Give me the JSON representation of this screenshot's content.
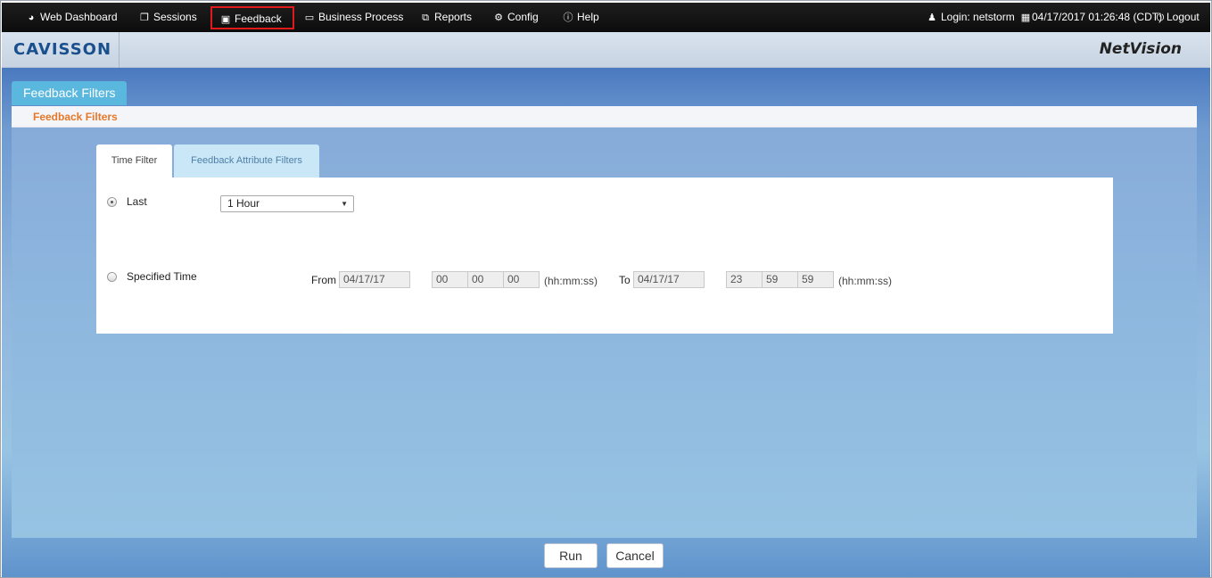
{
  "nav": {
    "web_dashboard": "Web Dashboard",
    "sessions": "Sessions",
    "feedback": "Feedback",
    "business_process": "Business Process",
    "reports": "Reports",
    "config": "Config",
    "help": "Help",
    "login": "Login: netstorm",
    "datetime": "04/17/2017 01:26:48 (CDT)",
    "logout": "Logout"
  },
  "brand": {
    "logo": "CAVISSON",
    "product": "NetVision"
  },
  "page": {
    "tab_title": "Feedback Filters",
    "breadcrumb": "Feedback Filters"
  },
  "tabs": [
    {
      "label": "Time Filter",
      "active": true
    },
    {
      "label": "Feedback Attribute Filters",
      "active": false
    }
  ],
  "filters": {
    "last_label": "Last",
    "last_selected": true,
    "last_value": "1 Hour",
    "specified_label": "Specified Time",
    "specified_selected": false,
    "from_label": "From",
    "from_date": "04/17/17",
    "from_hh": "00",
    "from_mm": "00",
    "from_ss": "00",
    "time_hint": "(hh:mm:ss)",
    "to_label": "To",
    "to_date": "04/17/17",
    "to_hh": "23",
    "to_mm": "59",
    "to_ss": "59"
  },
  "buttons": {
    "run": "Run",
    "cancel": "Cancel"
  },
  "colors": {
    "accent_tab": "#5ab8de",
    "breadcrumb": "#e57829",
    "active_highlight": "#e01a1a"
  }
}
